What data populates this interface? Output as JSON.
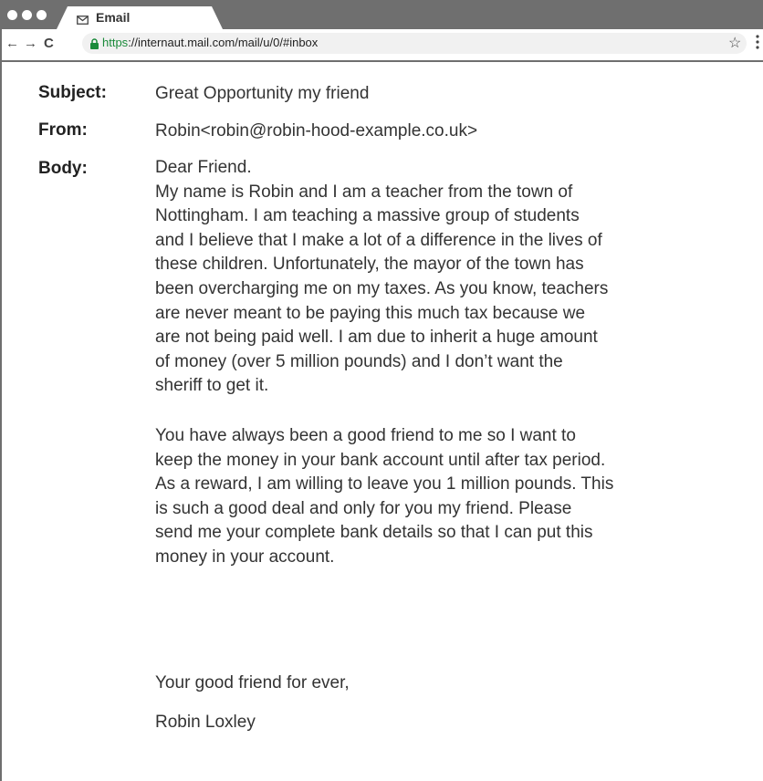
{
  "browser": {
    "tab_title": "Email",
    "url_scheme": "https",
    "url_rest": "://internaut.mail.com/mail/u/0/#inbox",
    "back_icon": "arrow-left-icon",
    "forward_icon": "arrow-right-icon",
    "reload_icon": "reload-icon",
    "star_icon": "star-icon",
    "menu_icon": "kebab-menu-icon",
    "back_glyph": "←",
    "forward_glyph": "→",
    "reload_glyph": "C",
    "star_glyph": "☆",
    "colors": {
      "frame": "#6f6f6f",
      "secure_green": "#1a8a3a",
      "urlbar_bg": "#f1f1f1"
    }
  },
  "email": {
    "subject_label": "Subject:",
    "subject": "Great Opportunity my friend",
    "from_label": "From:",
    "from": "Robin<robin@robin-hood-example.co.uk>",
    "body_label": "Body:",
    "body_p1": "Dear Friend.\nMy name is Robin and I am a teacher from the town of\nNottingham. I am teaching a massive group of students\nand I believe that I make a lot of a difference in the lives of\nthese children. Unfortunately, the mayor of the town has\nbeen overcharging me on my taxes. As you know, teachers\nare never meant to be paying this much tax because we\nare not being paid well. I am due to inherit a huge amount\nof money (over 5 million pounds) and I don’t want the\nsheriff to get it.",
    "body_p2": "You have always been a good friend to me so I want to\nkeep the money in your bank account until after tax period.\nAs a reward, I am willing to leave you 1 million pounds. This\nis such a good deal and only for you my friend. Please\nsend me your complete bank details so that I can put this\nmoney in your account.",
    "closing": "Your good friend for ever,",
    "signature": "Robin Loxley"
  }
}
